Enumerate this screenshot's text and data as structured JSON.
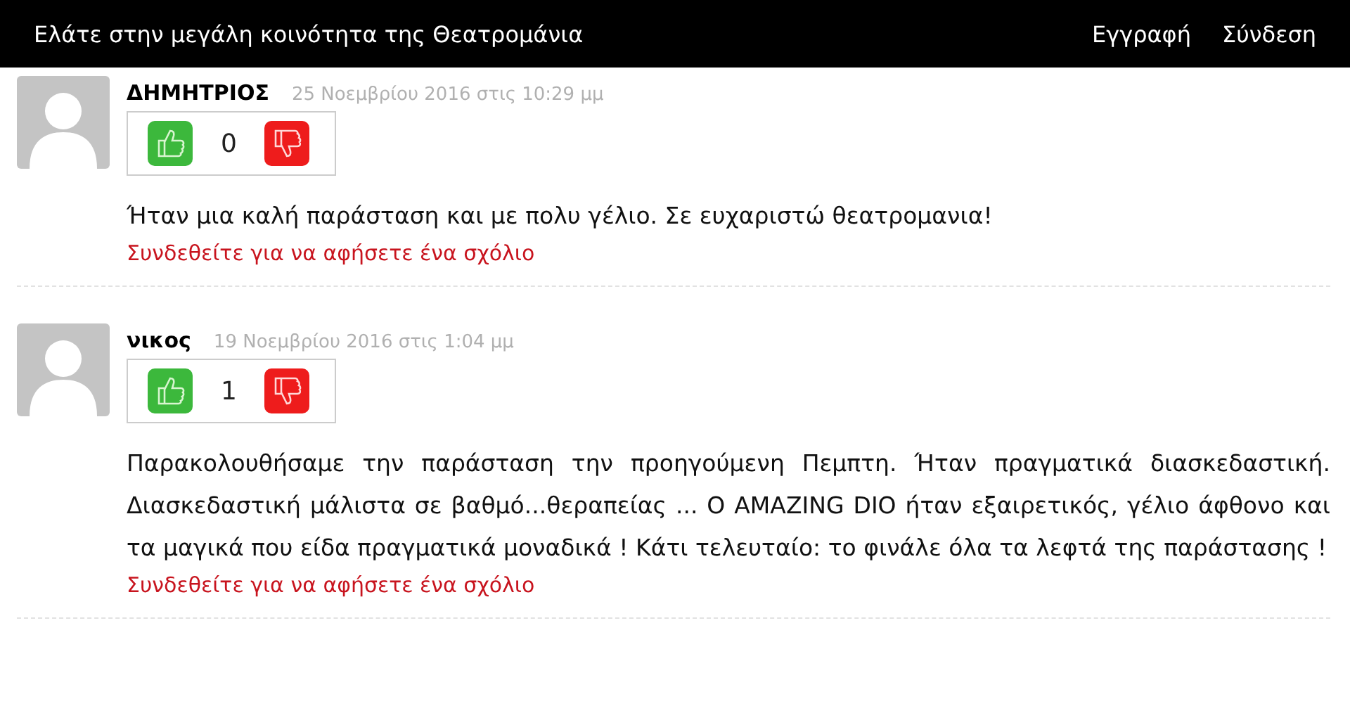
{
  "header": {
    "title": "Ελάτε στην μεγάλη κοινότητα της Θεατρομάνια",
    "links": [
      "Εγγραφή",
      "Σύνδεση"
    ]
  },
  "comments": [
    {
      "author": "ΔΗΜΗΤΡΙΟΣ",
      "date": "25 Νοεμβρίου 2016 στις 10:29 μμ",
      "votes": "0",
      "text": "Ήταν μια καλή παράσταση και με πολυ γέλιο. Σε ευχαριστώ θεατρομανια!",
      "login_link": "Συνδεθείτε για να αφήσετε ένα σχόλιο"
    },
    {
      "author": "νικος",
      "date": "19 Νοεμβρίου 2016 στις 1:04 μμ",
      "votes": "1",
      "text": "Παρακολουθήσαμε την παράσταση την προηγούμενη Πεμπτη. Ήταν πραγματικά διασκεδαστική. Διασκεδαστική μάλιστα σε βαθμό...θεραπείας ... Ο AMAZING DIO ήταν εξαιρετικός, γέλιο άφθονο και τα μαγικά που είδα πραγματικά μοναδικά ! Κάτι τελευταίο: το φινάλε όλα τα λεφτά της παράστασης !",
      "login_link": "Συνδεθείτε για να αφήσετε ένα σχόλιο"
    }
  ]
}
